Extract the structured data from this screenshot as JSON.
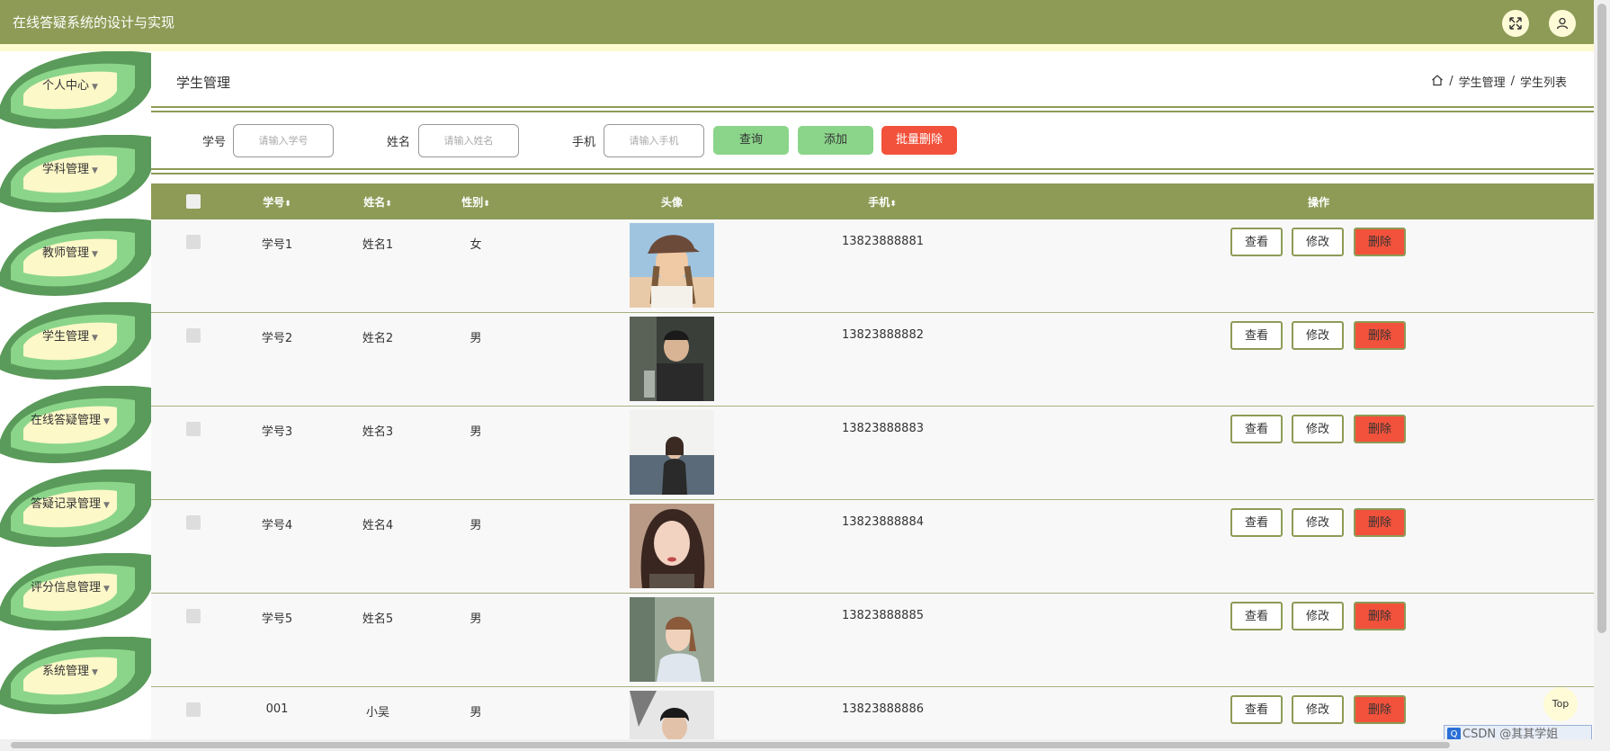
{
  "header": {
    "title": "在线答疑系统的设计与实现"
  },
  "sidebar": {
    "items": [
      {
        "label": "个人中心",
        "caret": "▼"
      },
      {
        "label": "学科管理",
        "caret": "▼"
      },
      {
        "label": "教师管理",
        "caret": "▼"
      },
      {
        "label": "学生管理",
        "caret": "▼"
      },
      {
        "label": "在线答疑管理",
        "caret": "▼"
      },
      {
        "label": "答疑记录管理",
        "caret": "▼"
      },
      {
        "label": "评分信息管理",
        "caret": "▼"
      },
      {
        "label": "系统管理",
        "caret": "▼"
      }
    ]
  },
  "page": {
    "title": "学生管理",
    "breadcrumb": [
      "学生管理",
      "学生列表"
    ],
    "separator": "/"
  },
  "search": {
    "student_no_label": "学号",
    "student_no_placeholder": "请输入学号",
    "name_label": "姓名",
    "name_placeholder": "请输入姓名",
    "phone_label": "手机",
    "phone_placeholder": "请输入手机",
    "query_label": "查询",
    "add_label": "添加",
    "batch_delete_label": "批量删除"
  },
  "table": {
    "columns": [
      "学号",
      "姓名",
      "性别",
      "头像",
      "手机",
      "操作"
    ],
    "sort_glyph": "⬍",
    "actions": {
      "view": "查看",
      "edit": "修改",
      "delete": "删除"
    },
    "rows": [
      {
        "student_no": "学号1",
        "name": "姓名1",
        "gender": "女",
        "phone": "13823888881"
      },
      {
        "student_no": "学号2",
        "name": "姓名2",
        "gender": "男",
        "phone": "13823888882"
      },
      {
        "student_no": "学号3",
        "name": "姓名3",
        "gender": "男",
        "phone": "13823888883"
      },
      {
        "student_no": "学号4",
        "name": "姓名4",
        "gender": "男",
        "phone": "13823888884"
      },
      {
        "student_no": "学号5",
        "name": "姓名5",
        "gender": "男",
        "phone": "13823888885"
      },
      {
        "student_no": "001",
        "name": "小吴",
        "gender": "男",
        "phone": "13823888886"
      }
    ]
  },
  "top_button": {
    "label": "Top"
  },
  "watermark": {
    "text": "CSDN @其其学姐"
  },
  "colors": {
    "header": "#8d9b56",
    "leaf_dark": "#5a9a5a",
    "leaf_light": "#8bd58a",
    "leaf_cream": "#fdf8c8",
    "delete": "#f2523b"
  }
}
